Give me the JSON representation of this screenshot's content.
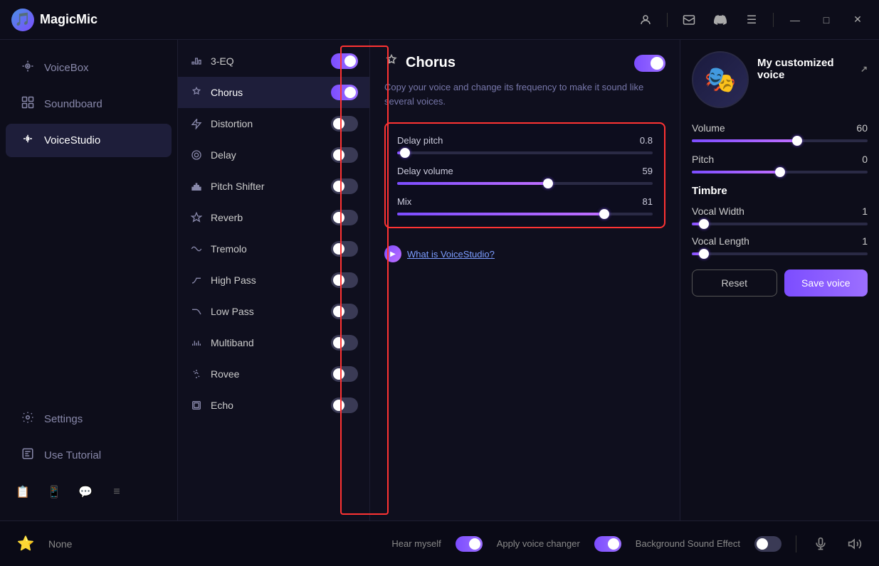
{
  "app": {
    "name": "MagicMic",
    "logo": "🎵"
  },
  "titlebar": {
    "icons": [
      "👤",
      "✉",
      "🎮",
      "☰"
    ],
    "window_controls": [
      "—",
      "□",
      "✕"
    ]
  },
  "sidebar": {
    "items": [
      {
        "id": "voicebox",
        "label": "VoiceBox",
        "icon": "🎤",
        "active": false
      },
      {
        "id": "soundboard",
        "label": "Soundboard",
        "icon": "🎛",
        "active": false
      },
      {
        "id": "voicestudio",
        "label": "VoiceStudio",
        "icon": "⚙",
        "active": true
      }
    ],
    "bottom": [
      {
        "id": "settings",
        "label": "Settings",
        "icon": "⚙"
      },
      {
        "id": "tutorial",
        "label": "Use Tutorial",
        "icon": "📖"
      }
    ],
    "footer_icons": [
      "📋",
      "📱",
      "💬",
      "≡"
    ]
  },
  "effects": [
    {
      "id": "eq3",
      "label": "3-EQ",
      "icon": "📊",
      "enabled": true
    },
    {
      "id": "chorus",
      "label": "Chorus",
      "icon": "✦",
      "enabled": true,
      "active": true
    },
    {
      "id": "distortion",
      "label": "Distortion",
      "icon": "⚡",
      "enabled": false
    },
    {
      "id": "delay",
      "label": "Delay",
      "icon": "◎",
      "enabled": false
    },
    {
      "id": "pitch_shifter",
      "label": "Pitch Shifter",
      "icon": "📶",
      "enabled": false
    },
    {
      "id": "reverb",
      "label": "Reverb",
      "icon": "✳",
      "enabled": false
    },
    {
      "id": "tremolo",
      "label": "Tremolo",
      "icon": "W",
      "enabled": false
    },
    {
      "id": "high_pass",
      "label": "High Pass",
      "icon": "⋀",
      "enabled": false
    },
    {
      "id": "low_pass",
      "label": "Low Pass",
      "icon": "⋁",
      "enabled": false
    },
    {
      "id": "multiband",
      "label": "Multiband",
      "icon": "▐▐▐",
      "enabled": false
    },
    {
      "id": "rovee",
      "label": "Rovee",
      "icon": "👆",
      "enabled": false
    },
    {
      "id": "echo",
      "label": "Echo",
      "icon": "🔲",
      "enabled": false
    }
  ],
  "chorus": {
    "title": "Chorus",
    "description": "Copy your voice and change its frequency to make it sound like several voices.",
    "enabled": true,
    "params": {
      "delay_pitch": {
        "label": "Delay pitch",
        "value": 0.8,
        "min": 0,
        "max": 1,
        "percent": 3
      },
      "delay_volume": {
        "label": "Delay volume",
        "value": 59,
        "min": 0,
        "max": 100,
        "percent": 59
      },
      "mix": {
        "label": "Mix",
        "value": 81,
        "min": 0,
        "max": 100,
        "percent": 81
      }
    }
  },
  "what_is": {
    "label": "What is ",
    "link_text": "VoiceStudio?",
    "prefix": "What is "
  },
  "custom_voice": {
    "title": "My customized voice",
    "avatar": "🎭",
    "volume": {
      "label": "Volume",
      "value": 60,
      "percent": 60
    },
    "pitch": {
      "label": "Pitch",
      "value": 0,
      "percent": 50
    },
    "timbre": {
      "title": "Timbre",
      "vocal_width": {
        "label": "Vocal Width",
        "value": 1,
        "percent": 7
      },
      "vocal_length": {
        "label": "Vocal Length",
        "value": 1,
        "percent": 7
      }
    }
  },
  "bottombar": {
    "none_label": "None",
    "hear_myself": {
      "label": "Hear myself",
      "enabled": true
    },
    "apply_voice": {
      "label": "Apply voice changer",
      "enabled": true
    },
    "bg_sound": {
      "label": "Background Sound Effect",
      "enabled": false
    }
  }
}
